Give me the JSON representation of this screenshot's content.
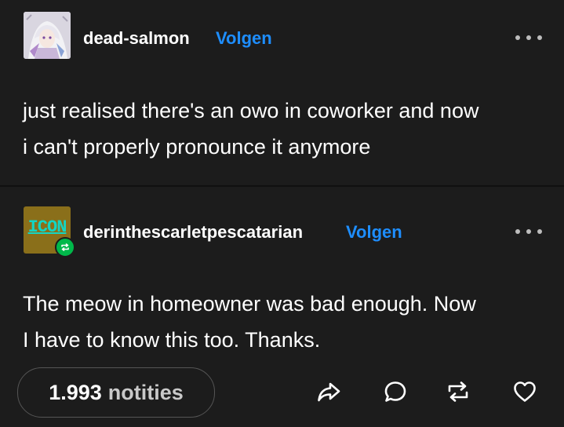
{
  "post1": {
    "username": "dead-salmon",
    "follow_label": "Volgen",
    "body_lines": [
      "just realised there's an owo in coworker and now",
      "i can't properly pronounce it anymore"
    ]
  },
  "post2": {
    "avatar_text": "ICON",
    "username": "derinthescarletpescatarian",
    "follow_label": "Volgen",
    "body_lines": [
      "The meow in homeowner was bad enough. Now",
      "I have to know this too. Thanks."
    ]
  },
  "footer": {
    "notes_count": "1.993",
    "notes_label": "notities",
    "actions": [
      "share-icon",
      "reply-icon",
      "reblog-icon",
      "like-icon"
    ]
  },
  "colors": {
    "background": "#1c1c1c",
    "follow": "#1e8eff",
    "reblog_badge": "#00b84a",
    "icon_avatar_text": "#12d6c5",
    "icon_avatar_bg": "#8a6f1a"
  }
}
